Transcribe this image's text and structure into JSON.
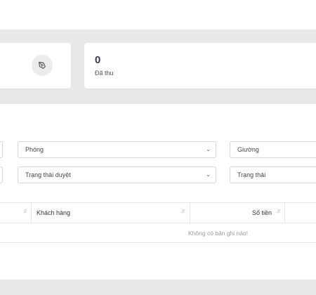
{
  "stats": [
    {
      "icon": "pen-icon"
    },
    {
      "value": "0",
      "label": "Đã thu"
    }
  ],
  "filters": {
    "room": "Phòng",
    "bed": "Giường",
    "approval_status": "Trạng thái duyệt",
    "status": "Trạng thái"
  },
  "table": {
    "columns": [
      "Khách hàng",
      "Số tiền"
    ],
    "empty_message": "Không có bản ghi nào!"
  },
  "colors": {
    "background": "#e9e9e9",
    "card": "#ffffff",
    "value_text": "#3a3a4a",
    "muted_text": "#9a9a9a"
  }
}
